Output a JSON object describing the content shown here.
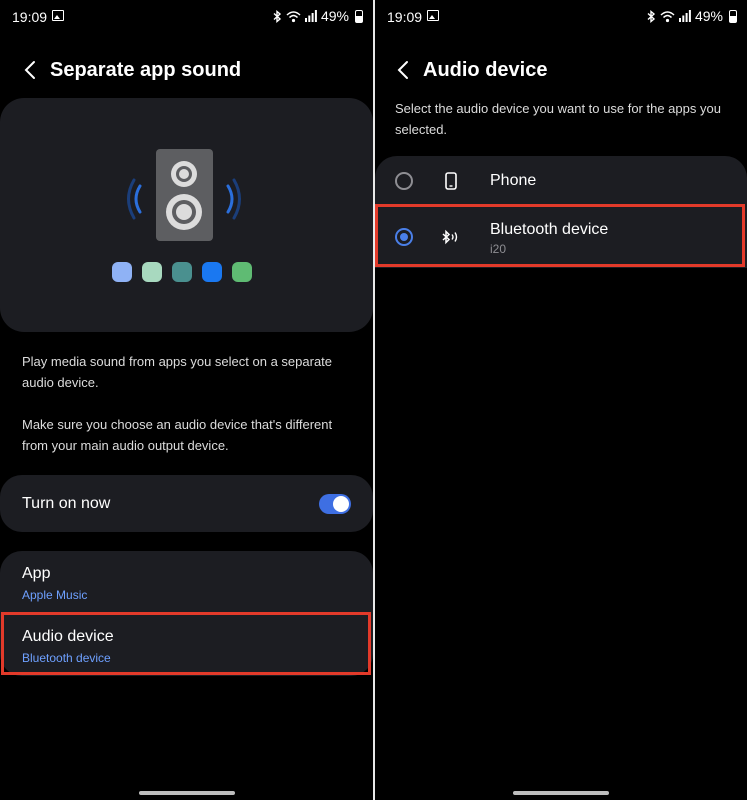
{
  "status": {
    "time": "19:09",
    "battery": "49%"
  },
  "left": {
    "title": "Separate app sound",
    "desc1": "Play media sound from apps you select on a separate audio device.",
    "desc2": "Make sure you choose an audio device that's different from your main audio output device.",
    "toggle": {
      "label": "Turn on now",
      "on": true
    },
    "items": [
      {
        "title": "App",
        "subtitle": "Apple Music"
      },
      {
        "title": "Audio device",
        "subtitle": "Bluetooth device"
      }
    ],
    "hero_dot_colors": [
      "#8fb2f5",
      "#a8d9bf",
      "#4a908f",
      "#1a78f1",
      "#5fbb73"
    ]
  },
  "right": {
    "title": "Audio device",
    "description": "Select the audio device you want to use for the apps you selected.",
    "options": [
      {
        "title": "Phone",
        "subtitle": "",
        "selected": false,
        "icon": "phone-icon"
      },
      {
        "title": "Bluetooth device",
        "subtitle": "i20",
        "selected": true,
        "icon": "bluetooth-audio-icon"
      }
    ]
  },
  "colors": {
    "accent": "#3e6fe3",
    "link": "#6ea0ff",
    "highlight": "#e23a2a",
    "card": "#1c1d22"
  }
}
